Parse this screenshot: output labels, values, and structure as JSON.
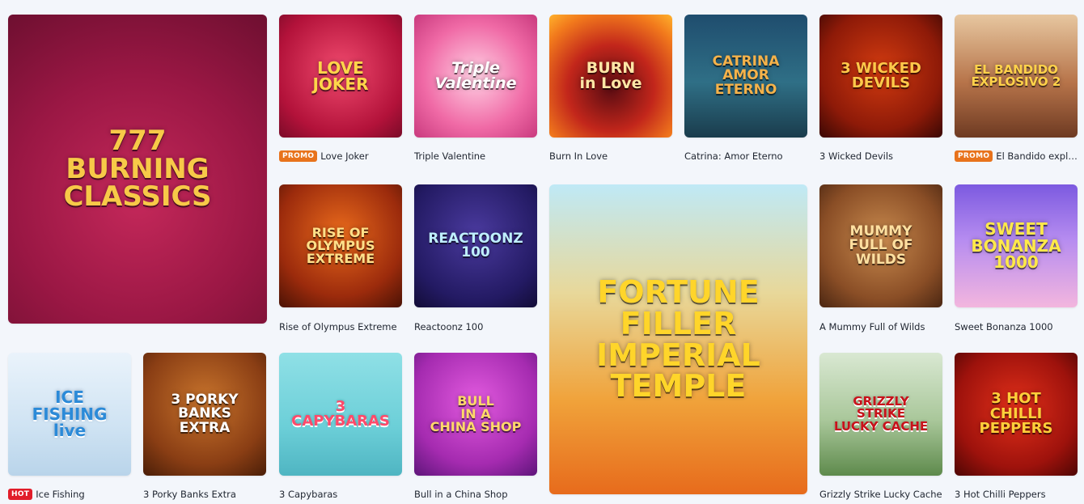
{
  "colors": {
    "promo": "#e8731c",
    "hot": "#e11d2a"
  },
  "games": [
    {
      "id": "burning-classics",
      "title": "",
      "badge": "",
      "art": "777\nBURNING CLASSICS"
    },
    {
      "id": "love-joker",
      "title": "Love Joker",
      "badge": "PROMO",
      "art": "LOVE\nJOKER"
    },
    {
      "id": "triple-valentine",
      "title": "Triple Valentine",
      "badge": "",
      "art": "Triple\nValentine"
    },
    {
      "id": "burn-in-love",
      "title": "Burn In Love",
      "badge": "",
      "art": "BURN\nin Love"
    },
    {
      "id": "catrina",
      "title": "Catrina: Amor Eterno",
      "badge": "",
      "art": "CATRINA\nAMOR ETERNO"
    },
    {
      "id": "3-wicked-devils",
      "title": "3 Wicked Devils",
      "badge": "",
      "art": "3 WICKED\nDEVILS"
    },
    {
      "id": "el-bandido",
      "title": "El Bandido explosi...",
      "badge": "PROMO",
      "art": "EL BANDIDO\nEXPLOSIVO 2"
    },
    {
      "id": "rise-of-olympus",
      "title": "Rise of Olympus Extreme",
      "badge": "",
      "art": "RISE OF\nOLYMPUS\nEXTREME"
    },
    {
      "id": "reactoonz-100",
      "title": "Reactoonz 100",
      "badge": "",
      "art": "REACTOONZ\n100"
    },
    {
      "id": "fortune-filler",
      "title": "",
      "badge": "",
      "art": "FORTUNE\nFILLER\nIMPERIAL TEMPLE"
    },
    {
      "id": "mummy",
      "title": "A Mummy Full of Wilds",
      "badge": "",
      "art": "MUMMY\nFULL OF\nWILDS"
    },
    {
      "id": "sweet-bonanza",
      "title": "Sweet Bonanza 1000",
      "badge": "",
      "art": "SWEET\nBONANZA\n1000"
    },
    {
      "id": "ice-fishing",
      "title": "Ice Fishing",
      "badge": "HOT",
      "art": "ICE\nFISHING\nlive"
    },
    {
      "id": "porky-banks",
      "title": "3 Porky Banks Extra",
      "badge": "",
      "art": "3 PORKY\nBANKS\nEXTRA"
    },
    {
      "id": "capybaras",
      "title": "3 Capybaras",
      "badge": "",
      "art": "3\nCAPYBARAS"
    },
    {
      "id": "bull-china",
      "title": "Bull in a China Shop",
      "badge": "",
      "art": "BULL\nIN A\nCHINA SHOP"
    },
    {
      "id": "grizzly",
      "title": "Grizzly Strike Lucky Cache",
      "badge": "",
      "art": "GRIZZLY\nSTRIKE\nLUCKY CACHE"
    },
    {
      "id": "hot-chilli",
      "title": "3 Hot Chilli Peppers",
      "badge": "",
      "art": "3 HOT\nCHILLI\nPEPPERS"
    }
  ]
}
